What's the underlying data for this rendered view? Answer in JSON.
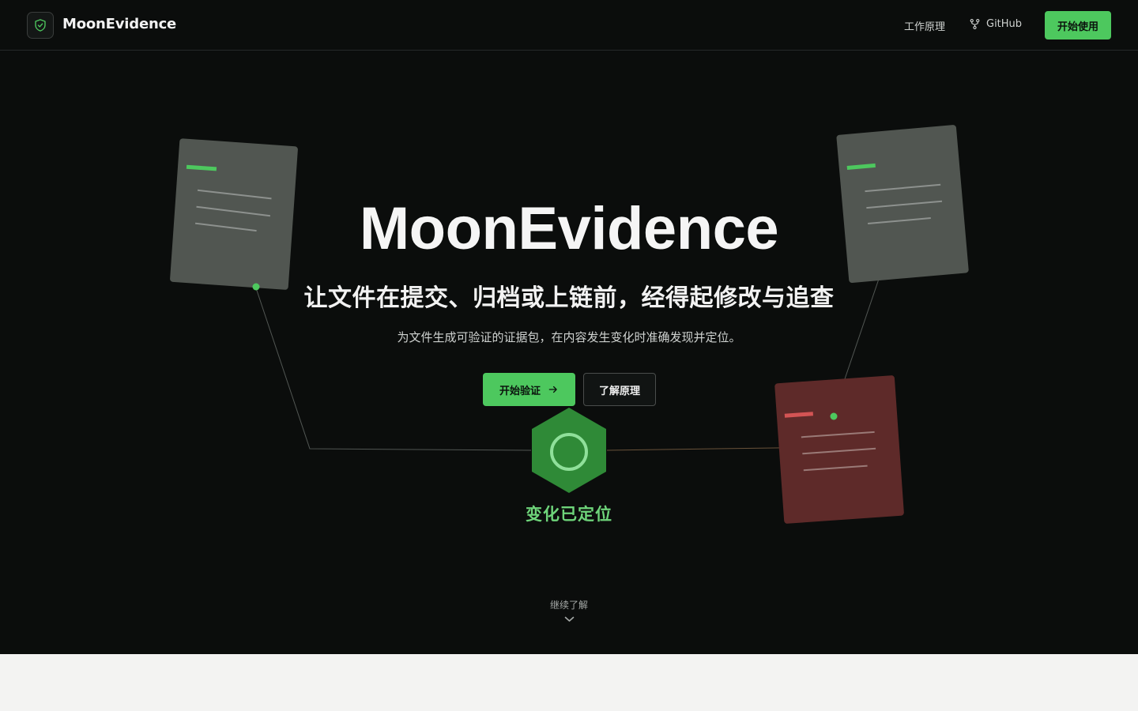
{
  "header": {
    "brand": "MoonEvidence",
    "nav": {
      "how_it_works": "工作原理",
      "github": "GitHub",
      "cta": "开始使用"
    }
  },
  "hero": {
    "title": "MoonEvidence",
    "subtitle": "让文件在提交、归档或上链前，经得起修改与追查",
    "description": "为文件生成可验证的证据包，在内容发生变化时准确发现并定位。",
    "primary_button": "开始验证",
    "secondary_button": "了解原理",
    "status": "变化已定位",
    "scroll_hint": "继续了解"
  },
  "colors": {
    "accent": "#4dc85e",
    "background": "#0b0d0c",
    "document": "#515651",
    "document_tampered": "#5e2a29",
    "hexagon": "#2f8a37"
  },
  "icons": [
    "shield-check-icon",
    "github-fork-icon",
    "arrow-right-icon",
    "chevron-down-icon",
    "verified-ring-icon"
  ]
}
